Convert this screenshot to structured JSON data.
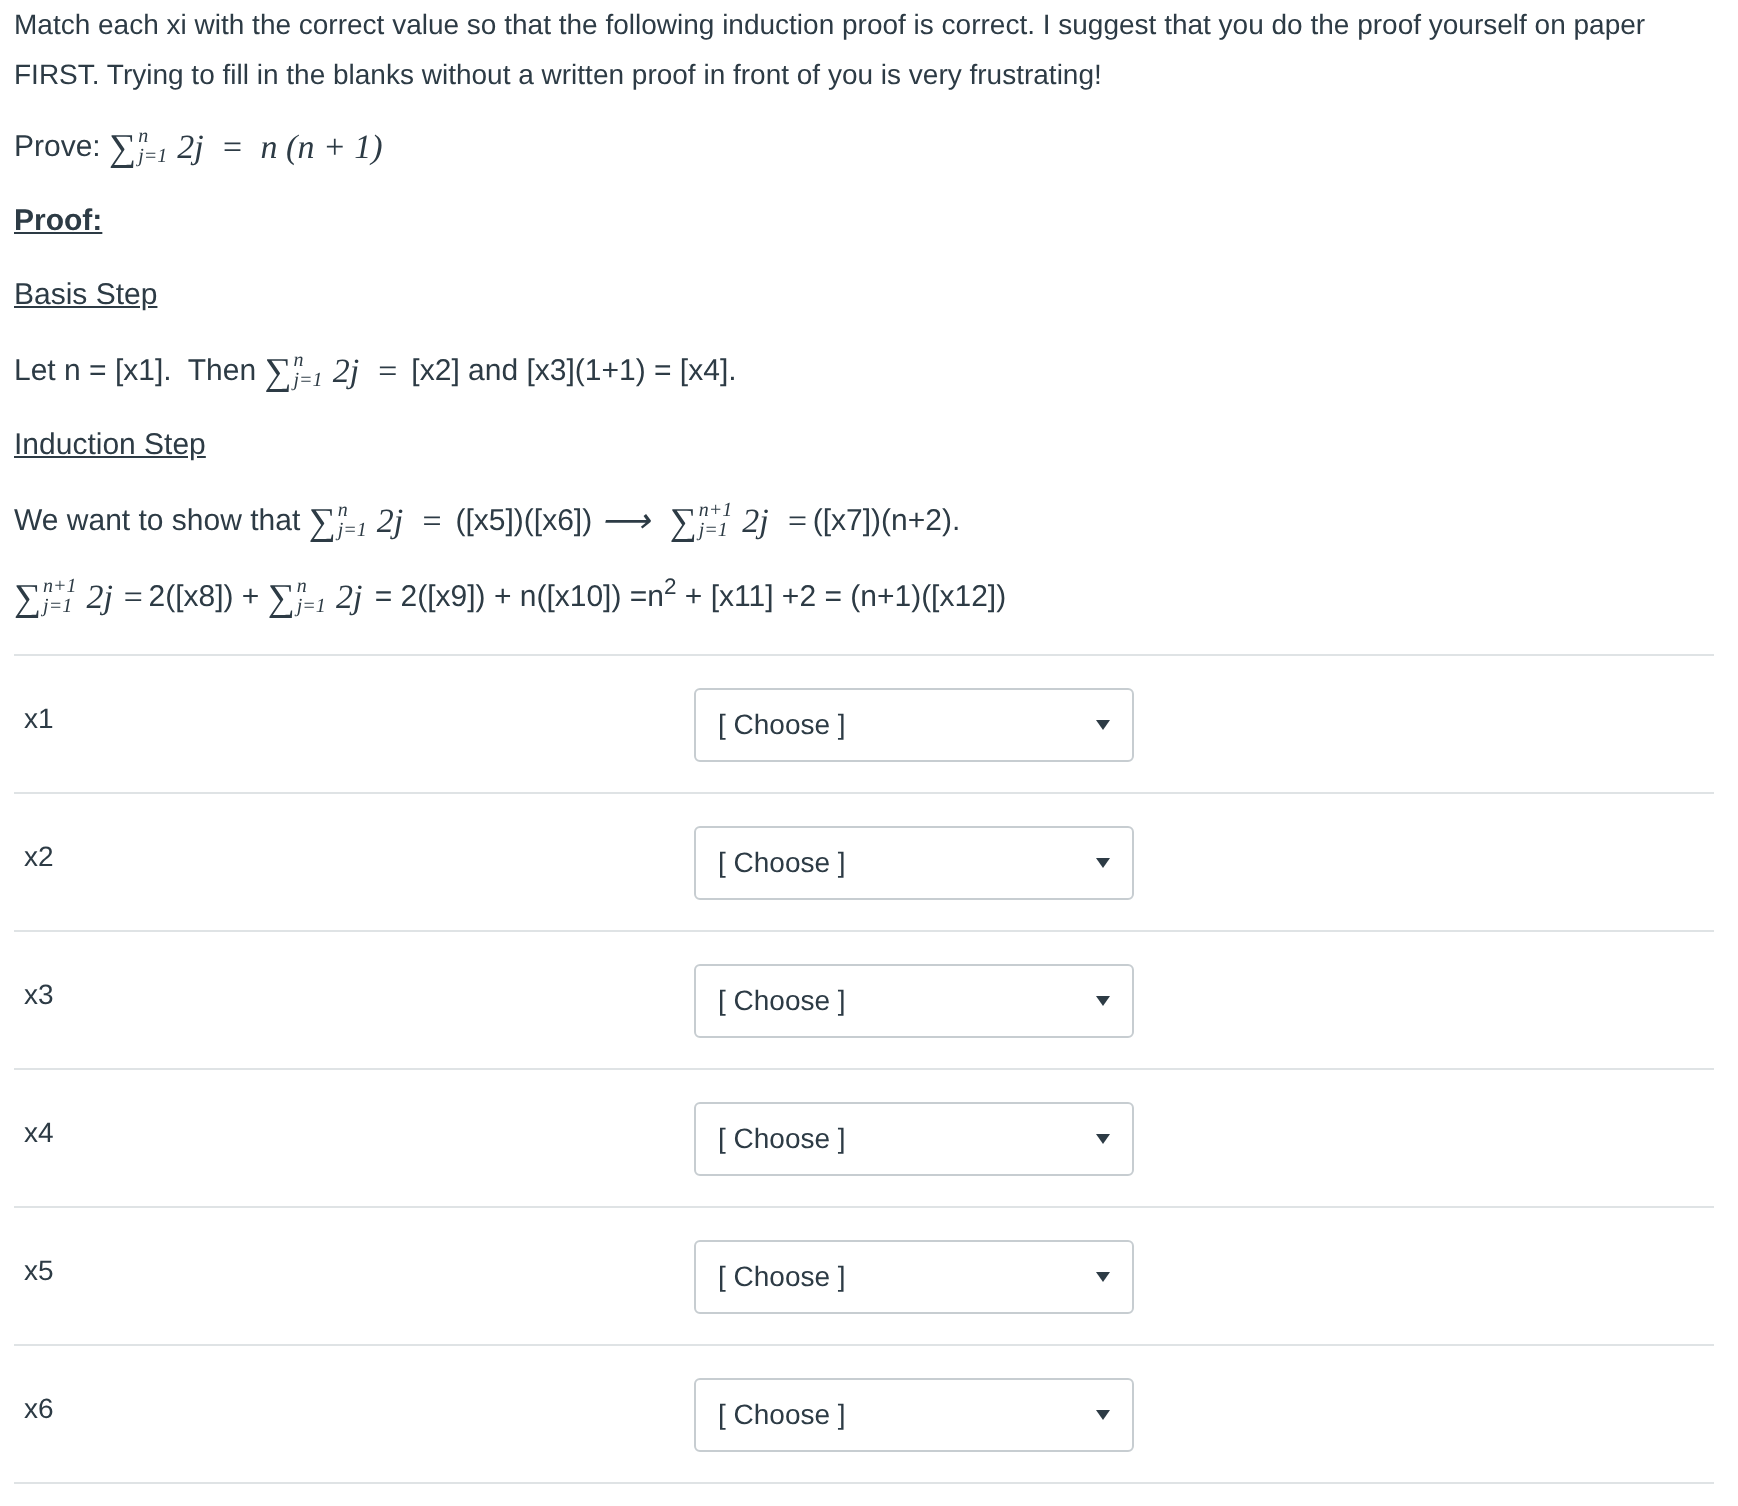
{
  "instructions": "Match each xi with the correct value so that the following induction proof is correct.  I suggest that you do the proof yourself on paper FIRST.  Trying to fill in the blanks without a written proof in front of you is very frustrating!",
  "blocks": [
    {
      "kind": "line",
      "segments": [
        {
          "kind": "text",
          "text": "Prove: "
        },
        {
          "kind": "sum",
          "symbol": "∑",
          "upper": "n",
          "lower": "j=1"
        },
        {
          "kind": "math",
          "text": "2j  =  n (n + 1)"
        }
      ]
    },
    {
      "kind": "heading",
      "text": "Proof:",
      "bold": true
    },
    {
      "kind": "heading",
      "text": "Basis Step",
      "bold": false
    },
    {
      "kind": "line",
      "segments": [
        {
          "kind": "text",
          "text": "Let n = [x1].  Then "
        },
        {
          "kind": "sum",
          "symbol": "∑",
          "upper": "n",
          "lower": "j=1"
        },
        {
          "kind": "math",
          "text": "2j  ="
        },
        {
          "kind": "text",
          "text": " [x2] and [x3](1+1) = [x4]."
        }
      ]
    },
    {
      "kind": "heading",
      "text": "Induction Step",
      "bold": false
    },
    {
      "kind": "line",
      "segments": [
        {
          "kind": "text",
          "text": "We want to show that "
        },
        {
          "kind": "sum",
          "symbol": "∑",
          "upper": "n",
          "lower": "j=1"
        },
        {
          "kind": "math",
          "text": "2j  ="
        },
        {
          "kind": "text",
          "text": " ([x5])([x6])"
        },
        {
          "kind": "math",
          "text": " ⟶  "
        },
        {
          "kind": "sum",
          "symbol": "∑",
          "upper": "n+1",
          "lower": "j=1"
        },
        {
          "kind": "math",
          "text": "2j  ="
        },
        {
          "kind": "text",
          "text": "([x7])(n+2)."
        }
      ]
    },
    {
      "kind": "line",
      "segments": [
        {
          "kind": "sum",
          "symbol": "∑",
          "upper": "n+1",
          "lower": "j=1"
        },
        {
          "kind": "math",
          "text": "2j ="
        },
        {
          "kind": "text",
          "text": "2([x8]) + "
        },
        {
          "kind": "sum",
          "symbol": "∑",
          "upper": "n",
          "lower": "j=1"
        },
        {
          "kind": "math",
          "text": "2j"
        },
        {
          "kind": "text",
          "text": " = 2([x9]) + n([x10]) =n$^{2}$ + [x11] +2 = (n+1)([x12])"
        }
      ]
    }
  ],
  "matches": [
    {
      "label": "x1",
      "value": "[ Choose ]"
    },
    {
      "label": "x2",
      "value": "[ Choose ]"
    },
    {
      "label": "x3",
      "value": "[ Choose ]"
    },
    {
      "label": "x4",
      "value": "[ Choose ]"
    },
    {
      "label": "x5",
      "value": "[ Choose ]"
    },
    {
      "label": "x6",
      "value": "[ Choose ]"
    }
  ]
}
